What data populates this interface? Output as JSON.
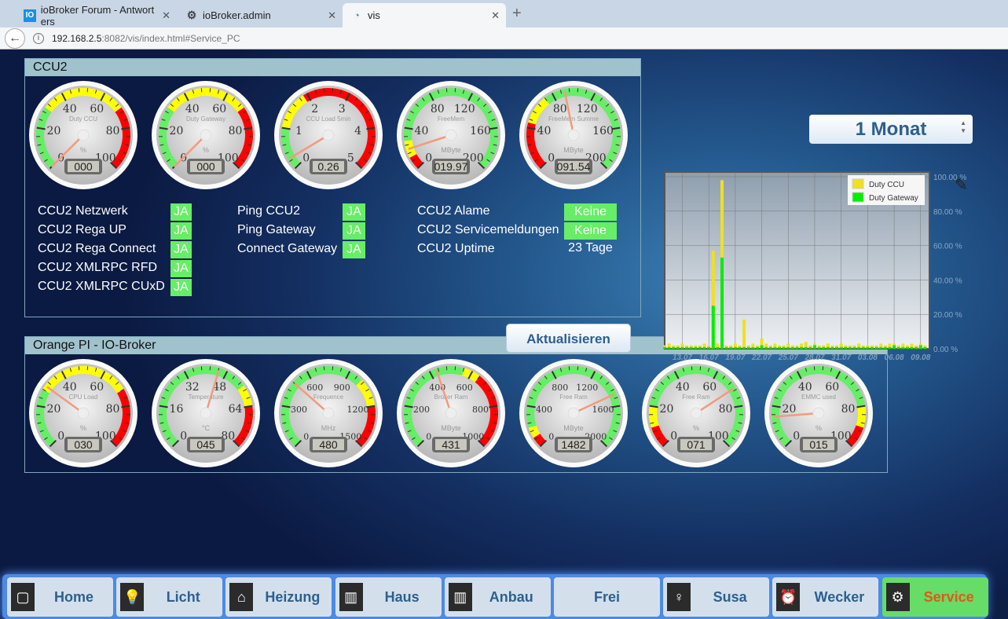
{
  "browser": {
    "tabs": [
      {
        "title": "ioBroker Forum - Antwort ers",
        "icon": "iobroker-logo-icon"
      },
      {
        "title": "ioBroker.admin",
        "icon": "gear-icon"
      },
      {
        "title": "vis",
        "icon": "gauge-icon"
      }
    ],
    "url_host": "192.168.2.5",
    "url_rest": ":8082/vis/index.html#Service_PC"
  },
  "ccu2": {
    "title": "CCU2",
    "status_col1": [
      {
        "label": "CCU2 Netzwerk",
        "value": "JA"
      },
      {
        "label": "CCU2 Rega UP",
        "value": "JA"
      },
      {
        "label": "CCU2 Rega Connect",
        "value": "JA"
      },
      {
        "label": "CCU2 XMLRPC RFD",
        "value": "JA"
      },
      {
        "label": "CCU2 XMLRPC CUxD",
        "value": "JA"
      }
    ],
    "status_col2": [
      {
        "label": "Ping CCU2",
        "value": "JA"
      },
      {
        "label": "Ping Gateway",
        "value": "JA"
      },
      {
        "label": "Connect Gateway",
        "value": "JA"
      }
    ],
    "status_col3": [
      {
        "label": "CCU2 Alame",
        "value": "Keine"
      },
      {
        "label": "CCU2 Servicemeldungen",
        "value": "Keine"
      },
      {
        "label": "CCU2 Uptime",
        "value": "23 Tage"
      }
    ],
    "refresh_label": "Aktualisieren",
    "gauges": [
      {
        "title": "Duty CCU",
        "unit": "%",
        "max": 100,
        "labels": [
          "0",
          "20",
          "40",
          "60",
          "80",
          "100"
        ],
        "zones": [
          [
            0,
            30,
            "#66ee66"
          ],
          [
            30,
            70,
            "#ffff00"
          ],
          [
            70,
            100,
            "#ff0000"
          ]
        ],
        "value": 0,
        "display": "000"
      },
      {
        "title": "Duty Gateway",
        "unit": "%",
        "max": 100,
        "labels": [
          "0",
          "20",
          "40",
          "60",
          "80",
          "100"
        ],
        "zones": [
          [
            0,
            30,
            "#66ee66"
          ],
          [
            30,
            70,
            "#ffff00"
          ],
          [
            70,
            100,
            "#ff0000"
          ]
        ],
        "value": 0,
        "display": "000"
      },
      {
        "title": "CCU Load 5min",
        "unit": "",
        "max": 5,
        "labels": [
          "0",
          "1",
          "2",
          "3",
          "4",
          "5"
        ],
        "zones": [
          [
            0,
            1,
            "#66ee66"
          ],
          [
            1,
            1.9,
            "#ffff00"
          ],
          [
            1.9,
            5,
            "#ff0000"
          ]
        ],
        "value": 0.26,
        "display": "0.26"
      },
      {
        "title": "FreeMem",
        "unit": "MByte",
        "max": 200,
        "labels": [
          "0",
          "40",
          "80",
          "120",
          "160",
          "200"
        ],
        "zones": [
          [
            0,
            12,
            "#ff0000"
          ],
          [
            12,
            28,
            "#ffff00"
          ],
          [
            28,
            200,
            "#66ee66"
          ]
        ],
        "value": 19.97,
        "display": "019.97"
      },
      {
        "title": "FreeMem Summe",
        "unit": "MByte",
        "max": 200,
        "labels": [
          "0",
          "40",
          "80",
          "120",
          "160",
          "200"
        ],
        "zones": [
          [
            0,
            45,
            "#ff0000"
          ],
          [
            45,
            72,
            "#ffff00"
          ],
          [
            72,
            200,
            "#66ee66"
          ]
        ],
        "value": 91.54,
        "display": "091.54"
      }
    ]
  },
  "range_select": {
    "value": "1 Monat"
  },
  "chart_data": {
    "type": "bar",
    "title": "",
    "xlabel": "",
    "ylabel": "",
    "ylim": [
      0,
      100
    ],
    "y_ticks": [
      "0.00 %",
      "20.00 %",
      "40.00 %",
      "60.00 %",
      "80.00 %",
      "100.00 %"
    ],
    "x_ticks": [
      "13.07",
      "16.07",
      "19.07",
      "22.07",
      "25.07",
      "28.07",
      "31.07",
      "03.08",
      "06.08",
      "09.08"
    ],
    "x_start_day": 11,
    "x_step_days": 0.5,
    "legend_position": "top-right",
    "series": [
      {
        "name": "Duty CCU",
        "color": "#f0e020",
        "values": [
          2,
          3,
          2,
          2,
          3,
          2,
          2,
          2,
          2,
          3,
          2,
          57,
          3,
          98,
          2,
          2,
          3,
          2,
          17,
          2,
          3,
          2,
          6,
          3,
          2,
          3,
          2,
          2,
          3,
          2,
          2,
          3,
          4,
          2,
          3,
          2,
          2,
          3,
          2,
          2,
          3,
          2,
          2,
          2,
          3,
          2,
          2,
          2,
          2,
          3,
          2,
          3,
          3,
          2,
          3,
          2,
          3,
          2,
          3,
          2
        ]
      },
      {
        "name": "Duty Gateway",
        "color": "#00ee00",
        "values": [
          1,
          1,
          1,
          1,
          1,
          1,
          1,
          1,
          1,
          1,
          1,
          25,
          1,
          53,
          1,
          1,
          1,
          1,
          1,
          1,
          1,
          1,
          2,
          1,
          1,
          1,
          1,
          1,
          1,
          1,
          1,
          1,
          1,
          1,
          2,
          1,
          1,
          1,
          1,
          1,
          1,
          1,
          1,
          1,
          1,
          1,
          1,
          1,
          1,
          1,
          1,
          1,
          2,
          1,
          1,
          1,
          1,
          1,
          2,
          1
        ]
      }
    ]
  },
  "orange": {
    "title": "Orange PI - IO-Broker",
    "gauges": [
      {
        "title": "CPU Load",
        "unit": "%",
        "max": 100,
        "labels": [
          "0",
          "20",
          "40",
          "60",
          "80",
          "100"
        ],
        "zones": [
          [
            0,
            28,
            "#66ee66"
          ],
          [
            28,
            72,
            "#ffff00"
          ],
          [
            72,
            100,
            "#ff0000"
          ]
        ],
        "value": 30,
        "display": "030"
      },
      {
        "title": "Temperature",
        "unit": "°C",
        "max": 80,
        "labels": [
          "0",
          "16",
          "32",
          "48",
          "64",
          "80"
        ],
        "zones": [
          [
            0,
            56,
            "#66ee66"
          ],
          [
            56,
            64,
            "#ffff00"
          ],
          [
            64,
            80,
            "#ff0000"
          ]
        ],
        "value": 45,
        "display": "045"
      },
      {
        "title": "Frequence",
        "unit": "MHz",
        "max": 1500,
        "labels": [
          "0",
          "300",
          "600",
          "900",
          "1200",
          "1500"
        ],
        "zones": [
          [
            0,
            1000,
            "#66ee66"
          ],
          [
            1000,
            1200,
            "#ffff00"
          ],
          [
            1200,
            1500,
            "#ff0000"
          ]
        ],
        "value": 480,
        "display": "480"
      },
      {
        "title": "Broker Ram",
        "unit": "MByte",
        "max": 1000,
        "labels": [
          "0",
          "200",
          "400",
          "600",
          "800",
          "1000"
        ],
        "zones": [
          [
            0,
            560,
            "#66ee66"
          ],
          [
            560,
            640,
            "#ffff00"
          ],
          [
            640,
            1000,
            "#ff0000"
          ]
        ],
        "value": 431,
        "display": "431"
      },
      {
        "title": "Free Ram",
        "unit": "MByte",
        "max": 2000,
        "labels": [
          "0",
          "400",
          "800",
          "1200",
          "1600",
          "2000"
        ],
        "zones": [
          [
            0,
            100,
            "#ff0000"
          ],
          [
            100,
            200,
            "#ffff00"
          ],
          [
            200,
            2000,
            "#66ee66"
          ]
        ],
        "value": 1482,
        "display": "1482"
      },
      {
        "title": "Free Ram",
        "unit": "%",
        "max": 100,
        "labels": [
          "0",
          "20",
          "40",
          "60",
          "80",
          "100"
        ],
        "zones": [
          [
            0,
            10,
            "#ff0000"
          ],
          [
            10,
            20,
            "#ffff00"
          ],
          [
            20,
            100,
            "#66ee66"
          ]
        ],
        "value": 71,
        "display": "071"
      },
      {
        "title": "EMMC used",
        "unit": "%",
        "max": 100,
        "labels": [
          "0",
          "20",
          "40",
          "60",
          "80",
          "100"
        ],
        "zones": [
          [
            0,
            80,
            "#66ee66"
          ],
          [
            80,
            90,
            "#ffff00"
          ],
          [
            90,
            100,
            "#ff0000"
          ]
        ],
        "value": 15,
        "display": "015"
      }
    ]
  },
  "nav": [
    {
      "label": "Home",
      "icon": "home-icon",
      "glyph": "▢"
    },
    {
      "label": "Licht",
      "icon": "light-bulb-icon",
      "glyph": "💡"
    },
    {
      "label": "Heizung",
      "icon": "house-heating-icon",
      "glyph": "⌂"
    },
    {
      "label": "Haus",
      "icon": "radiator-icon",
      "glyph": "▥"
    },
    {
      "label": "Anbau",
      "icon": "radiator-icon",
      "glyph": "▥"
    },
    {
      "label": "Frei",
      "icon": "",
      "glyph": ""
    },
    {
      "label": "Susa",
      "icon": "person-icon",
      "glyph": "♀"
    },
    {
      "label": "Wecker",
      "icon": "alarm-clock-icon",
      "glyph": "⏰"
    },
    {
      "label": "Service",
      "icon": "gears-icon",
      "glyph": "⚙",
      "active": true
    }
  ],
  "colors": {
    "ok": "#66ee66",
    "nav_bg": "#4d8ae6",
    "nav_active": "#66dd66",
    "accent_text": "#2e5f8e"
  }
}
